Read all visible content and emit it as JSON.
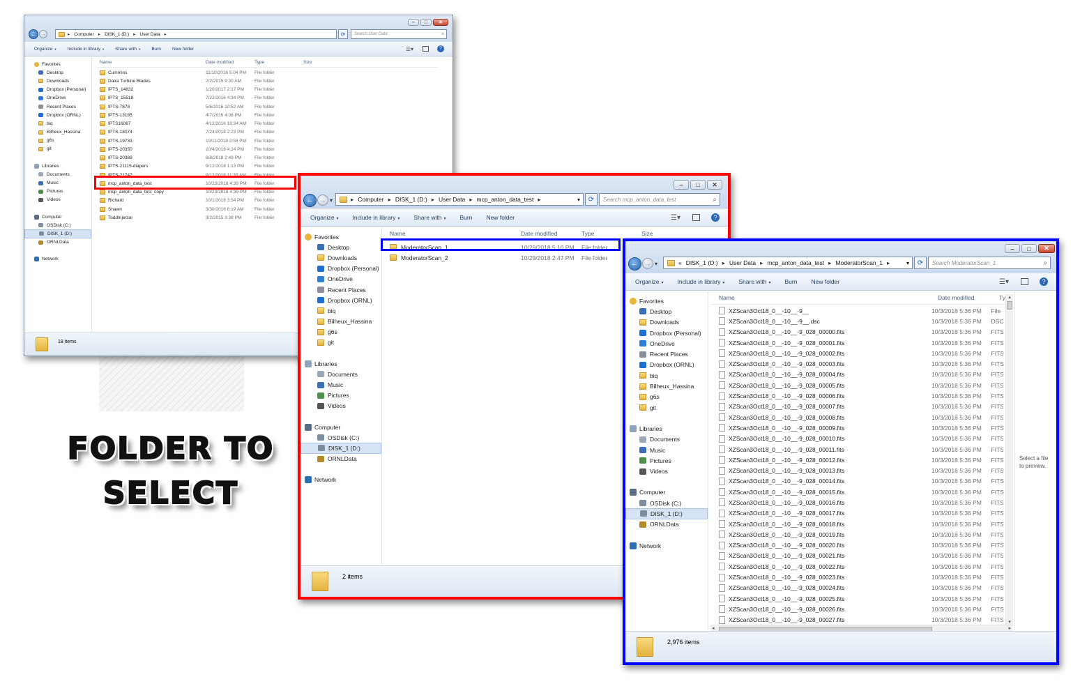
{
  "annotation": {
    "label_line1": "FOLDER TO",
    "label_line2": "SELECT",
    "arrow": "up-arrow-icon",
    "colors": {
      "window2_outline": "#ff0000",
      "window3_outline": "#0000ff",
      "folder_highlight_red": "#ff0000",
      "folder_highlight_blue": "#0000ff"
    }
  },
  "nav_common": {
    "favorites": "Favorites",
    "favorite_items": [
      "Desktop",
      "Downloads",
      "Dropbox (Personal)",
      "OneDrive",
      "Recent Places",
      "Dropbox (ORNL)",
      "biq",
      "Bilheux_Hassina",
      "g6s",
      "git"
    ],
    "libraries": "Libraries",
    "library_items": [
      "Documents",
      "Music",
      "Pictures",
      "Videos"
    ],
    "computer": "Computer",
    "computer_items": [
      "OSDisk (C:)",
      "DISK_1 (D:)",
      "ORNLData"
    ],
    "network": "Network"
  },
  "cmd_common": {
    "organize": "Organize",
    "include": "Include in library",
    "share": "Share with",
    "burn": "Burn",
    "new_folder": "New folder"
  },
  "cols_common": {
    "name": "Name",
    "date": "Date modified",
    "type": "Type",
    "size": "Size"
  },
  "window1": {
    "breadcrumb": [
      "Computer",
      "DISK_1 (D:)",
      "User Data"
    ],
    "search_placeholder": "Search User Data",
    "rows": [
      {
        "name": "Cummins",
        "date": "11/10/2016 5:04 PM",
        "type": "File folder"
      },
      {
        "name": "Daira Turbine Blades",
        "date": "2/2/2015 9:30 AM",
        "type": "File folder"
      },
      {
        "name": "IPTS_14832",
        "date": "1/20/2017 2:17 PM",
        "type": "File folder"
      },
      {
        "name": "IPTS_15518",
        "date": "7/22/2016 4:34 PM",
        "type": "File folder"
      },
      {
        "name": "IPTS-7878",
        "date": "5/6/2016 10:52 AM",
        "type": "File folder"
      },
      {
        "name": "IPTS-13185",
        "date": "4/7/2016 4:06 PM",
        "type": "File folder"
      },
      {
        "name": "IPTS16087",
        "date": "4/12/2016 10:34 AM",
        "type": "File folder"
      },
      {
        "name": "IPTS-18074",
        "date": "7/24/2018 2:23 PM",
        "type": "File folder"
      },
      {
        "name": "IPTS-19733",
        "date": "10/11/2018 2:58 PM",
        "type": "File folder"
      },
      {
        "name": "IPTS-20350",
        "date": "10/4/2018 4:24 PM",
        "type": "File folder"
      },
      {
        "name": "IPTS-20389",
        "date": "8/8/2018 2:49 PM",
        "type": "File folder"
      },
      {
        "name": "IPTS-21115-diapers",
        "date": "9/12/2018 1:13 PM",
        "type": "File folder"
      },
      {
        "name": "IPTS-21747",
        "date": "9/12/2018 11:35 AM",
        "type": "File folder"
      },
      {
        "name": "mcp_anton_data_test",
        "date": "10/23/2018 4:39 PM",
        "type": "File folder"
      },
      {
        "name": "mcp_anton_data_test_copy",
        "date": "10/23/2018 4:39 PM",
        "type": "File folder"
      },
      {
        "name": "Richard",
        "date": "10/1/2018 3:54 PM",
        "type": "File folder"
      },
      {
        "name": "Shawn",
        "date": "3/30/2016 8:19 AM",
        "type": "File folder"
      },
      {
        "name": "ToddInjector",
        "date": "3/2/2015 3:38 PM",
        "type": "File folder"
      }
    ],
    "status": "18 items"
  },
  "window2": {
    "breadcrumb": [
      "Computer",
      "DISK_1 (D:)",
      "User Data",
      "mcp_anton_data_test"
    ],
    "search_placeholder": "Search mcp_anton_data_test",
    "rows": [
      {
        "name": "ModeratorScan_1",
        "date": "10/29/2018 5:10 PM",
        "type": "File folder"
      },
      {
        "name": "ModeratorScan_2",
        "date": "10/29/2018 2:47 PM",
        "type": "File folder"
      }
    ],
    "status": "2 items"
  },
  "window3": {
    "breadcrumb_prefix": "«",
    "breadcrumb": [
      "DISK_1 (D:)",
      "User Data",
      "mcp_anton_data_test",
      "ModeratorScan_1"
    ],
    "search_placeholder": "Search ModeratorScan_1",
    "type_header": "Typ",
    "preview": "Select a file to preview.",
    "rows": [
      {
        "name": "XZScan3Oct18_0__-10__-9__",
        "date": "10/3/2018 5:36 PM",
        "type": "File"
      },
      {
        "name": "XZScan3Oct18_0__-10__-9__.dsc",
        "date": "10/3/2018 5:36 PM",
        "type": "DSC"
      },
      {
        "name": "XZScan3Oct18_0__-10__-9_028_00000.fits",
        "date": "10/3/2018 5:36 PM",
        "type": "FITS"
      },
      {
        "name": "XZScan3Oct18_0__-10__-9_028_00001.fits",
        "date": "10/3/2018 5:36 PM",
        "type": "FITS"
      },
      {
        "name": "XZScan3Oct18_0__-10__-9_028_00002.fits",
        "date": "10/3/2018 5:36 PM",
        "type": "FITS"
      },
      {
        "name": "XZScan3Oct18_0__-10__-9_028_00003.fits",
        "date": "10/3/2018 5:36 PM",
        "type": "FITS"
      },
      {
        "name": "XZScan3Oct18_0__-10__-9_028_00004.fits",
        "date": "10/3/2018 5:36 PM",
        "type": "FITS"
      },
      {
        "name": "XZScan3Oct18_0__-10__-9_028_00005.fits",
        "date": "10/3/2018 5:36 PM",
        "type": "FITS"
      },
      {
        "name": "XZScan3Oct18_0__-10__-9_028_00006.fits",
        "date": "10/3/2018 5:36 PM",
        "type": "FITS"
      },
      {
        "name": "XZScan3Oct18_0__-10__-9_028_00007.fits",
        "date": "10/3/2018 5:36 PM",
        "type": "FITS"
      },
      {
        "name": "XZScan3Oct18_0__-10__-9_028_00008.fits",
        "date": "10/3/2018 5:36 PM",
        "type": "FITS"
      },
      {
        "name": "XZScan3Oct18_0__-10__-9_028_00009.fits",
        "date": "10/3/2018 5:36 PM",
        "type": "FITS"
      },
      {
        "name": "XZScan3Oct18_0__-10__-9_028_00010.fits",
        "date": "10/3/2018 5:36 PM",
        "type": "FITS"
      },
      {
        "name": "XZScan3Oct18_0__-10__-9_028_00011.fits",
        "date": "10/3/2018 5:36 PM",
        "type": "FITS"
      },
      {
        "name": "XZScan3Oct18_0__-10__-9_028_00012.fits",
        "date": "10/3/2018 5:36 PM",
        "type": "FITS"
      },
      {
        "name": "XZScan3Oct18_0__-10__-9_028_00013.fits",
        "date": "10/3/2018 5:36 PM",
        "type": "FITS"
      },
      {
        "name": "XZScan3Oct18_0__-10__-9_028_00014.fits",
        "date": "10/3/2018 5:36 PM",
        "type": "FITS"
      },
      {
        "name": "XZScan3Oct18_0__-10__-9_028_00015.fits",
        "date": "10/3/2018 5:36 PM",
        "type": "FITS"
      },
      {
        "name": "XZScan3Oct18_0__-10__-9_028_00016.fits",
        "date": "10/3/2018 5:36 PM",
        "type": "FITS"
      },
      {
        "name": "XZScan3Oct18_0__-10__-9_028_00017.fits",
        "date": "10/3/2018 5:36 PM",
        "type": "FITS"
      },
      {
        "name": "XZScan3Oct18_0__-10__-9_028_00018.fits",
        "date": "10/3/2018 5:36 PM",
        "type": "FITS"
      },
      {
        "name": "XZScan3Oct18_0__-10__-9_028_00019.fits",
        "date": "10/3/2018 5:36 PM",
        "type": "FITS"
      },
      {
        "name": "XZScan3Oct18_0__-10__-9_028_00020.fits",
        "date": "10/3/2018 5:36 PM",
        "type": "FITS"
      },
      {
        "name": "XZScan3Oct18_0__-10__-9_028_00021.fits",
        "date": "10/3/2018 5:36 PM",
        "type": "FITS"
      },
      {
        "name": "XZScan3Oct18_0__-10__-9_028_00022.fits",
        "date": "10/3/2018 5:36 PM",
        "type": "FITS"
      },
      {
        "name": "XZScan3Oct18_0__-10__-9_028_00023.fits",
        "date": "10/3/2018 5:36 PM",
        "type": "FITS"
      },
      {
        "name": "XZScan3Oct18_0__-10__-9_028_00024.fits",
        "date": "10/3/2018 5:36 PM",
        "type": "FITS"
      },
      {
        "name": "XZScan3Oct18_0__-10__-9_028_00025.fits",
        "date": "10/3/2018 5:36 PM",
        "type": "FITS"
      },
      {
        "name": "XZScan3Oct18_0__-10__-9_028_00026.fits",
        "date": "10/3/2018 5:36 PM",
        "type": "FITS"
      },
      {
        "name": "XZScan3Oct18_0__-10__-9_028_00027.fits",
        "date": "10/3/2018 5:36 PM",
        "type": "FITS"
      }
    ],
    "status": "2,976 items"
  }
}
